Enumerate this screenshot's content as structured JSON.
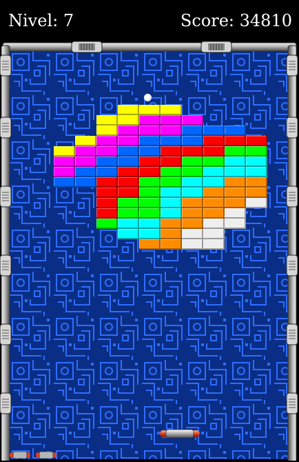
{
  "hud": {
    "level_text": "Nivel: 7",
    "score_text": "Score: 34810"
  },
  "game": {
    "lives_remaining": 2
  },
  "colors": {
    "background": "#0a2e85",
    "pattern": "#2f6dff",
    "frame": "#b7b7b7",
    "brick_yellow": "#ffff00",
    "brick_magenta": "#ff00ff",
    "brick_blue": "#0066ff",
    "brick_red": "#ff0000",
    "brick_green": "#00ff00",
    "brick_cyan": "#00ffff",
    "brick_orange": "#ff8c00",
    "brick_white": "#eeeeee"
  },
  "bricks": {
    "rows": [
      "...YYY....",
      "..YYMMM...",
      "..YMMMBBB.",
      ".YMMBBBRRR",
      "YMMBBRRRGG",
      "MMBBRRGGCC",
      "MBBRRGGCCC",
      "BBRRGGCCOO",
      "..RRGCCOOO",
      "..RGGCOOOW",
      "..RGGCOOW.",
      "..GCCOOWW.",
      "...CCOWW..",
      "....OOWW.."
    ],
    "legend": {
      "Y": "brick_yellow",
      "M": "brick_magenta",
      "B": "brick_blue",
      "R": "brick_red",
      "G": "brick_green",
      "C": "brick_cyan",
      "O": "brick_orange",
      "W": "brick_white"
    }
  }
}
